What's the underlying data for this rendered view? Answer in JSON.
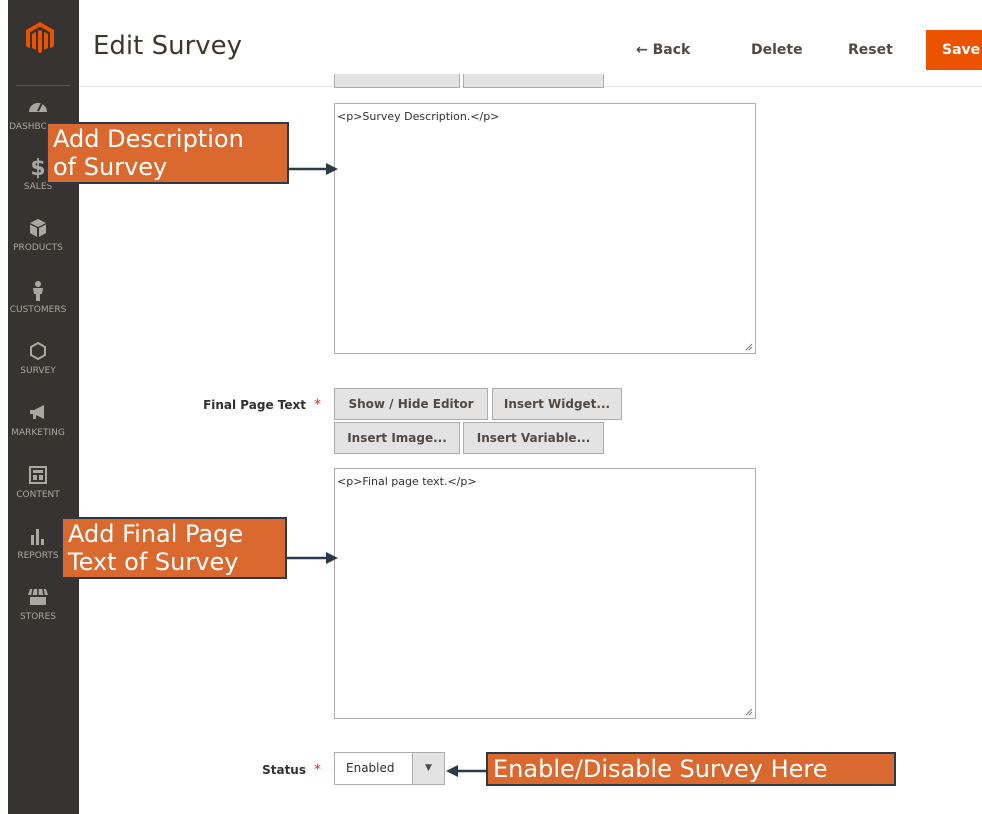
{
  "header": {
    "title": "Edit Survey",
    "back_label": "← Back",
    "delete_label": "Delete",
    "reset_label": "Reset",
    "save_label": "Save"
  },
  "sidebar": {
    "items": [
      {
        "label": "DASHBOARD",
        "icon": "dashboard-icon"
      },
      {
        "label": "SALES",
        "icon": "dollar-icon"
      },
      {
        "label": "PRODUCTS",
        "icon": "box-icon"
      },
      {
        "label": "CUSTOMERS",
        "icon": "person-icon"
      },
      {
        "label": "SURVEY",
        "icon": "hexagon-icon"
      },
      {
        "label": "MARKETING",
        "icon": "megaphone-icon"
      },
      {
        "label": "CONTENT",
        "icon": "layout-icon"
      },
      {
        "label": "REPORTS",
        "icon": "bar-chart-icon"
      },
      {
        "label": "STORES",
        "icon": "store-icon"
      }
    ]
  },
  "form": {
    "description_value": "<p>Survey Description.</p>",
    "final_page_label": "Final Page Text",
    "final_page_value": "<p>Final page text.</p>",
    "editor_buttons": {
      "show_hide": "Show / Hide Editor",
      "insert_widget": "Insert Widget...",
      "insert_image": "Insert Image...",
      "insert_variable": "Insert Variable..."
    },
    "status_label": "Status",
    "status_value": "Enabled",
    "required_mark": "*"
  },
  "annotations": {
    "description_line1": "Add Description",
    "description_line2": "of Survey",
    "final_line1": "Add Final Page",
    "final_line2": "Text of Survey",
    "status_note": "Enable/Disable Survey Here"
  },
  "colors": {
    "sidebar_bg": "#373330",
    "save_bg": "#eb5202",
    "callout_bg": "#d9692f",
    "callout_border": "#2b3a4a"
  }
}
